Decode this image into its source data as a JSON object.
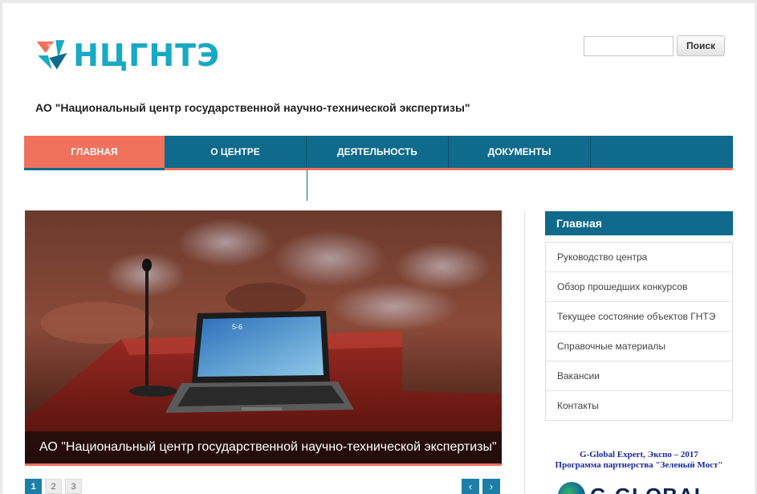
{
  "brand": {
    "logo_text": "НЦГНТЭ",
    "accent": "#18a9c4"
  },
  "search": {
    "placeholder": "",
    "button_label": "Поиск"
  },
  "org_title": "АО \"Национальный центр государственной научно-технической экспертизы\"",
  "nav": {
    "items": [
      {
        "label": "Главная",
        "active": true
      },
      {
        "label": "О центре"
      },
      {
        "label": "Деятельность"
      },
      {
        "label": "Документы"
      }
    ],
    "color": "#0f6a8b",
    "active_color": "#f0725c"
  },
  "slider": {
    "caption": "АО \"Национальный центр государственной научно-технической экспертизы\"",
    "screen_text": "5-6",
    "pages": [
      "1",
      "2",
      "3"
    ],
    "active_page": "1",
    "prev_icon": "‹",
    "next_icon": "›"
  },
  "sidebar": {
    "heading": "Главная",
    "items": [
      {
        "label": "Руководство центра"
      },
      {
        "label": "Обзор прошедших конкурсов"
      },
      {
        "label": "Текущее состояние объектов ГНТЭ"
      },
      {
        "label": "Справочные материалы"
      },
      {
        "label": "Вакансии"
      },
      {
        "label": "Контакты"
      }
    ]
  },
  "promo": {
    "line1": "G-Global Expert, Экспо – 2017",
    "line2": "Программа партнерства \"Зеленый Мост\"",
    "logo_text": "G-GLOBAL"
  }
}
